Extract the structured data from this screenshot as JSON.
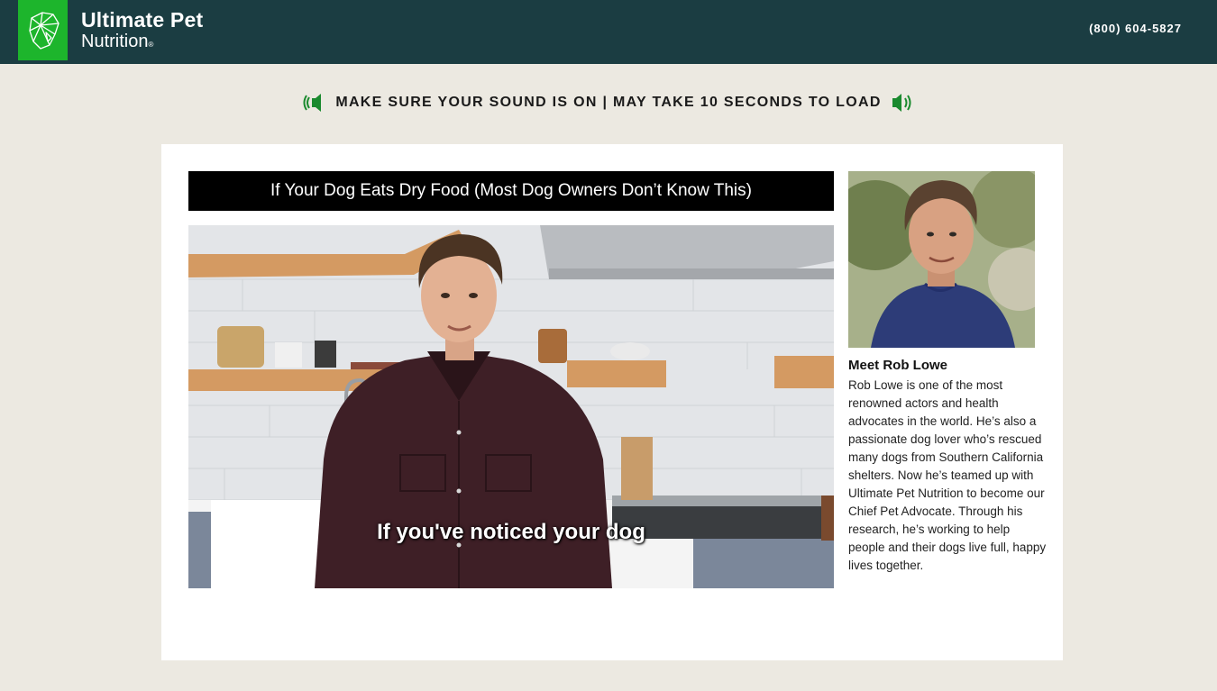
{
  "header": {
    "brand_line1": "Ultimate Pet",
    "brand_line2": "Nutrition",
    "brand_reg": "®",
    "phone": "(800) 604-5827",
    "logo_icon": "geometric-dog-head-icon",
    "bg_color": "#1b3d42",
    "logo_bg_color": "#1db52c"
  },
  "sound_notice": {
    "text": "MAKE SURE YOUR SOUND IS ON | MAY TAKE 10 SECONDS TO LOAD",
    "icons": [
      "speaker-left-icon",
      "speaker-right-icon"
    ],
    "icon_color": "#1a8a2e"
  },
  "video": {
    "title": "If Your Dog Eats Dry Food (Most Dog Owners Don’t Know This)",
    "caption": "If you've noticed your dog"
  },
  "sidebar": {
    "heading": "Meet Rob Lowe",
    "body": "Rob Lowe is one of the most renowned actors and health advocates in the world. He’s also a passionate dog lover who’s rescued many dogs from Southern California shelters. Now he’s teamed up with Ultimate Pet Nutrition to become our Chief Pet Advocate. Through his research, he’s working to help people and their dogs live full, happy lives together."
  }
}
